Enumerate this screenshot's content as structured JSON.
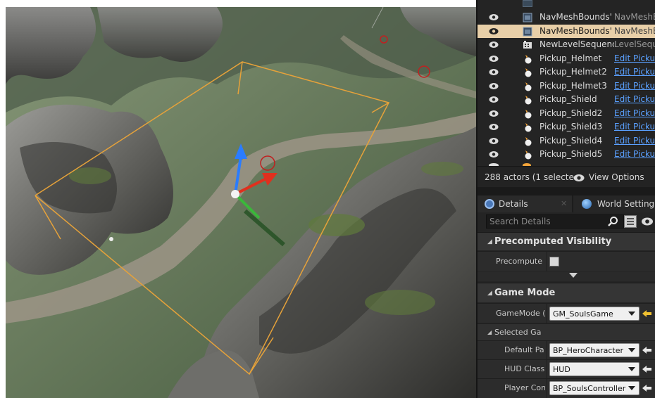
{
  "outliner": {
    "rows": [
      {
        "name": "NavMeshBounds'",
        "type": "NavMeshB",
        "style": "plain",
        "icon": "navmesh-icon",
        "selected": false
      },
      {
        "name": "NavMeshBounds'",
        "type": "NavMeshB",
        "style": "plain",
        "icon": "navmesh-icon",
        "selected": true
      },
      {
        "name": "NewLevelSequenc",
        "type": "LevelSeque",
        "style": "plain",
        "icon": "level-sequence-icon",
        "selected": false
      },
      {
        "name": "Pickup_Helmet",
        "type": "Edit Picku",
        "style": "link",
        "icon": "blueprint-pawn-icon",
        "selected": false
      },
      {
        "name": "Pickup_Helmet2",
        "type": "Edit Picku",
        "style": "link",
        "icon": "blueprint-pawn-icon",
        "selected": false
      },
      {
        "name": "Pickup_Helmet3",
        "type": "Edit Picku",
        "style": "link",
        "icon": "blueprint-pawn-icon",
        "selected": false
      },
      {
        "name": "Pickup_Shield",
        "type": "Edit Picku",
        "style": "link",
        "icon": "blueprint-pawn-icon",
        "selected": false
      },
      {
        "name": "Pickup_Shield2",
        "type": "Edit Picku",
        "style": "link",
        "icon": "blueprint-pawn-icon",
        "selected": false
      },
      {
        "name": "Pickup_Shield3",
        "type": "Edit Picku",
        "style": "link",
        "icon": "blueprint-pawn-icon",
        "selected": false
      },
      {
        "name": "Pickup_Shield4",
        "type": "Edit Picku",
        "style": "link",
        "icon": "blueprint-pawn-icon",
        "selected": false
      },
      {
        "name": "Pickup_Shield5",
        "type": "Edit Picku",
        "style": "link",
        "icon": "blueprint-pawn-icon",
        "selected": false
      }
    ],
    "actor_count": "288 actors (1 selecte",
    "view_options": "View Options"
  },
  "details": {
    "tabs": [
      {
        "label": "Details",
        "icon": "details-icon"
      },
      {
        "label": "World Setting",
        "icon": "globe-icon"
      }
    ],
    "search_placeholder": "Search Details",
    "categories": {
      "precomputed_visibility": {
        "label": "Precomputed Visibility",
        "prop_label": "Precompute",
        "checked": false
      },
      "game_mode": {
        "label": "Game Mode",
        "gamemode_label": "GameMode (",
        "gamemode_value": "GM_SoulsGame",
        "selected_label": "Selected Ga",
        "default_pawn_label": "Default Pa",
        "default_pawn_value": "BP_HeroCharacter",
        "hud_label": "HUD Class",
        "hud_value": "HUD",
        "player_controller_label": "Player Con",
        "player_controller_value": "BP_SoulsController"
      }
    }
  },
  "colors": {
    "selection": "#e8cfa8",
    "link": "#5aa0ff",
    "gizmo_z": "#2a7cff",
    "gizmo_x": "#e0301e",
    "gizmo_y": "#3ab83a",
    "bounds": "#e6a23a"
  }
}
